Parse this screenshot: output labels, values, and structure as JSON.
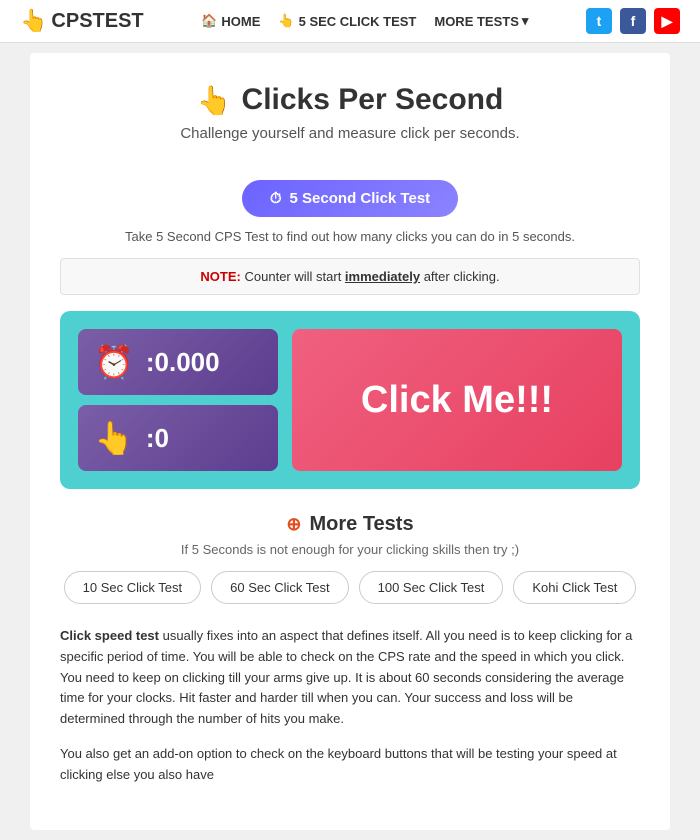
{
  "header": {
    "logo_text": "CPSTEST",
    "logo_icon": "👆",
    "nav": {
      "home_label": "HOME",
      "home_icon": "🏠",
      "click_test_label": "5 SEC CLICK TEST",
      "click_test_icon": "👆",
      "more_tests_label": "MORE TESTS",
      "more_tests_chevron": "▾"
    },
    "social": {
      "twitter_label": "t",
      "facebook_label": "f",
      "youtube_label": "▶"
    }
  },
  "hero": {
    "icon": "👆",
    "title": "Clicks Per Second",
    "subtitle": "Challenge yourself and measure click per seconds."
  },
  "cta": {
    "icon": "⏱",
    "button_label": "5 Second Click Test",
    "note": "Take 5 Second CPS Test to find out how many clicks you can do in 5 seconds."
  },
  "note_box": {
    "label": "NOTE:",
    "text_before": "Counter will start ",
    "highlight": "immediately",
    "text_after": " after clicking."
  },
  "click_area": {
    "time_icon": "⏰",
    "time_value": "0.000",
    "clicks_icon": "👆",
    "clicks_value": "0",
    "click_me_label": "Click Me!!!"
  },
  "more_tests": {
    "icon": "⊕",
    "title": "More Tests",
    "subtitle": "If 5 Seconds is not enough for your clicking skills then try ;)",
    "buttons": [
      {
        "label": "10 Sec Click Test"
      },
      {
        "label": "60 Sec Click Test"
      },
      {
        "label": "100 Sec Click Test"
      },
      {
        "label": "Kohi Click Test"
      }
    ]
  },
  "article": {
    "para1_bold": "Click speed test",
    "para1_text": " usually fixes into an aspect that defines itself. All you need is to keep clicking for a specific period of time. You will be able to check on the CPS rate and the speed in which you click. You need to keep on clicking till your arms give up. It is about 60 seconds considering the average time for your clocks. Hit faster and harder till when you can. Your success and loss will be determined through the number of hits you make.",
    "para2": "You also get an add-on option to check on the keyboard buttons that will be testing your speed at clicking else you also have"
  }
}
